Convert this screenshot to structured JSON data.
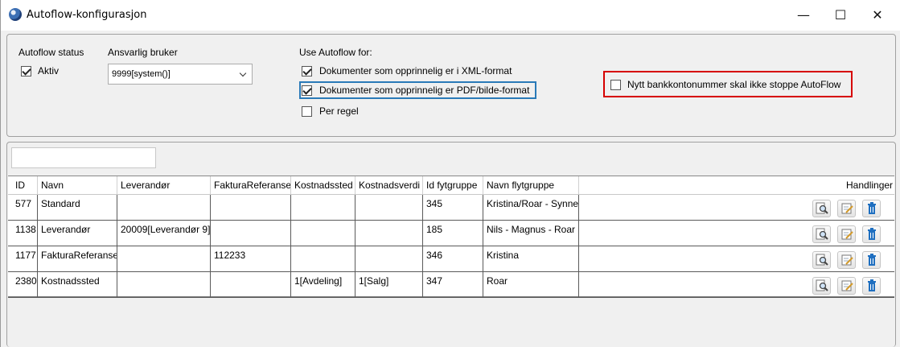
{
  "window": {
    "title": "Autoflow-konfigurasjon",
    "controls": {
      "minimize": "—",
      "maximize": "☐",
      "close": "✕"
    }
  },
  "settings": {
    "status_label": "Autoflow status",
    "active_label": "Aktiv",
    "active_checked": true,
    "responsible_label": "Ansvarlig bruker",
    "responsible_value": "9999[system()]",
    "use_for_label": "Use Autoflow for:",
    "options": [
      {
        "label": "Dokumenter som opprinnelig er i XML-format",
        "checked": true
      },
      {
        "label": "Dokumenter som opprinnelig er PDF/bilde-format",
        "checked": true
      },
      {
        "label": "Per regel",
        "checked": false
      }
    ],
    "bank_label": "Nytt bankkontonummer skal ikke stoppe AutoFlow",
    "bank_checked": false
  },
  "filter": {
    "placeholder": ""
  },
  "table": {
    "columns": [
      "ID",
      "Navn",
      "Leverandør",
      "FakturaReferanse",
      "Kostnadssted",
      "Kostnadsverdi",
      "Id fytgruppe",
      "Navn flytgruppe",
      "Handlinger"
    ],
    "rows": [
      {
        "id": "577",
        "navn": "Standard",
        "leverandor": "",
        "faktura": "",
        "kostnadssted": "",
        "kostnadsverdi": "",
        "idgruppe": "345",
        "navngruppe": "Kristina/Roar - Synne"
      },
      {
        "id": "1138",
        "navn": "Leverandør",
        "leverandor": "20009[Leverandør 9]",
        "faktura": "",
        "kostnadssted": "",
        "kostnadsverdi": "",
        "idgruppe": "185",
        "navngruppe": "Nils - Magnus - Roar"
      },
      {
        "id": "1177",
        "navn": "FakturaReferanse",
        "leverandor": "",
        "faktura": "112233",
        "kostnadssted": "",
        "kostnadsverdi": "",
        "idgruppe": "346",
        "navngruppe": "Kristina"
      },
      {
        "id": "2380",
        "navn": "Kostnadssted",
        "leverandor": "",
        "faktura": "",
        "kostnadssted": "1[Avdeling]",
        "kostnadsverdi": "1[Salg]",
        "idgruppe": "347",
        "navngruppe": "Roar"
      }
    ],
    "actions": [
      "view-icon",
      "edit-icon",
      "delete-icon"
    ]
  },
  "colors": {
    "highlight_red": "#d60000",
    "focus_blue": "#2a7ab8",
    "delete_blue": "#1f6fc0"
  }
}
